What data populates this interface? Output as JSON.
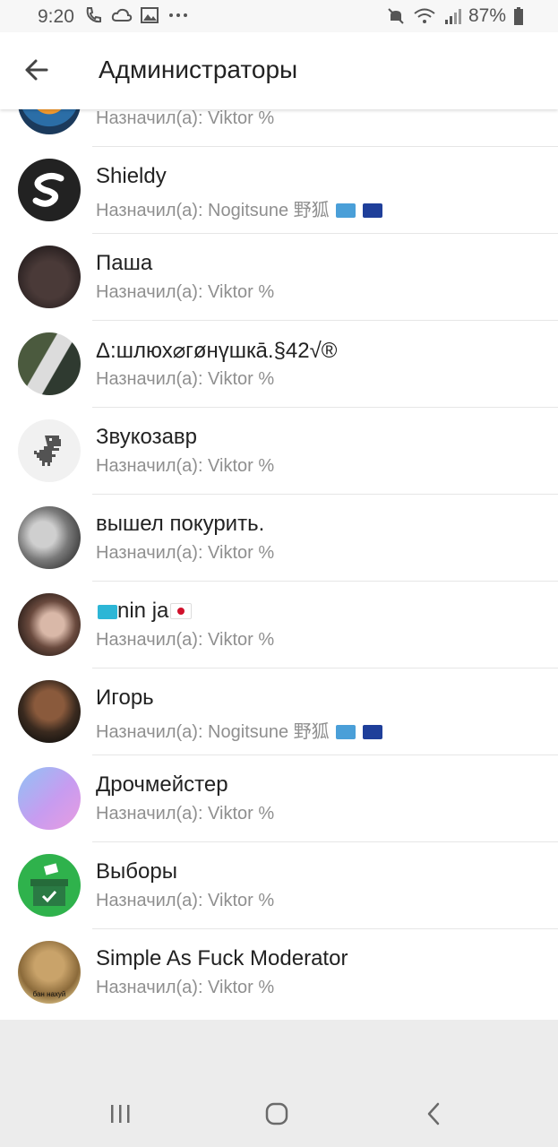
{
  "status_bar": {
    "time": "9:20",
    "battery": "87%",
    "left_icons": [
      "wifi-call-icon",
      "cloud-sync-icon",
      "gallery-icon",
      "more-dots-icon"
    ],
    "right_icons": [
      "mute-icon",
      "wifi-icon",
      "signal-icon",
      "battery-icon"
    ]
  },
  "app_bar": {
    "title": "Администраторы",
    "back_icon": "arrow-left-icon"
  },
  "admins": [
    {
      "name": "",
      "assigned": "Назначил(а): Viktor %",
      "flags": []
    },
    {
      "name": "Shieldy",
      "assigned": "Назначил(а): Nogitsune 野狐",
      "flags": [
        "un",
        "eu"
      ]
    },
    {
      "name": "Паша",
      "assigned": "Назначил(а): Viktor %",
      "flags": []
    },
    {
      "name": "Δ:шлюх⌀гøнүшкā.§42√®",
      "assigned": "Назначил(а): Viktor %",
      "flags": []
    },
    {
      "name": "Звукозавр",
      "assigned": "Назначил(а): Viktor %",
      "flags": []
    },
    {
      "name": "вышел покурить.",
      "assigned": "Назначил(а): Viktor %",
      "flags": []
    },
    {
      "name": "nin ja",
      "assigned": "Назначил(а): Viktor %",
      "flags": [
        "kz",
        "jp"
      ]
    },
    {
      "name": "Игорь",
      "assigned": "Назначил(а): Nogitsune 野狐",
      "flags": [
        "un",
        "eu"
      ]
    },
    {
      "name": "Дрочмейстер",
      "assigned": "Назначил(а): Viktor %",
      "flags": []
    },
    {
      "name": "Выборы",
      "assigned": "Назначил(а): Viktor %",
      "flags": []
    },
    {
      "name": "Simple As Fuck Moderator",
      "assigned": "Назначил(а): Viktor %",
      "flags": []
    }
  ],
  "avatar_caption": "бан нахуй",
  "nav_bar": {
    "icons": [
      "recent-apps-icon",
      "home-icon",
      "back-icon"
    ]
  },
  "colors": {
    "background": "#ececec",
    "list_bg": "#ffffff",
    "subtitle": "#8f8f8f"
  }
}
